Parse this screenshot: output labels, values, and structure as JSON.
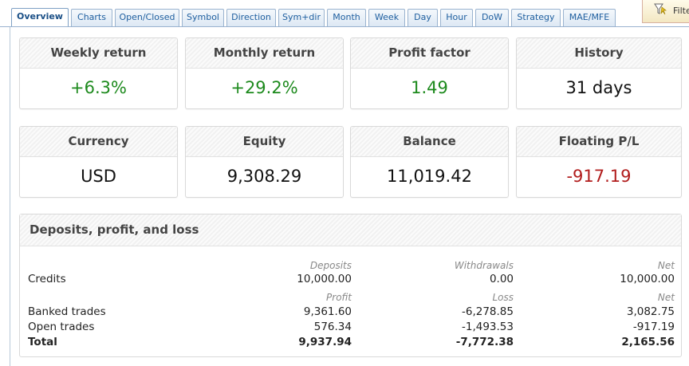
{
  "tabs": [
    {
      "label": "Overview",
      "active": true
    },
    {
      "label": "Charts"
    },
    {
      "label": "Open/Closed"
    },
    {
      "label": "Symbol"
    },
    {
      "label": "Direction"
    },
    {
      "label": "Sym+dir"
    },
    {
      "label": "Month"
    },
    {
      "label": "Week"
    },
    {
      "label": "Day"
    },
    {
      "label": "Hour"
    },
    {
      "label": "DoW"
    },
    {
      "label": "Strategy"
    },
    {
      "label": "MAE/MFE"
    }
  ],
  "filter": {
    "label": "Filte",
    "icon": "filter-funnel-icon"
  },
  "stats": {
    "weekly_return": {
      "title": "Weekly return",
      "value": "+6.3%"
    },
    "monthly_return": {
      "title": "Monthly return",
      "value": "+29.2%"
    },
    "profit_factor": {
      "title": "Profit factor",
      "value": "1.49"
    },
    "history": {
      "title": "History",
      "value": "31 days"
    },
    "currency": {
      "title": "Currency",
      "value": "USD"
    },
    "equity": {
      "title": "Equity",
      "value": "9,308.29"
    },
    "balance": {
      "title": "Balance",
      "value": "11,019.42"
    },
    "floating_pl": {
      "title": "Floating P/L",
      "value": "-917.19"
    }
  },
  "colors": {
    "positive": "#1d8a1d",
    "negative": "#b11c1c",
    "tab_text": "#1f5f9f"
  },
  "dpl": {
    "title": "Deposits, profit, and loss",
    "header1": {
      "c1": "Deposits",
      "c2": "Withdrawals",
      "c3": "Net"
    },
    "credits": {
      "label": "Credits",
      "c1": "10,000.00",
      "c2": "0.00",
      "c3": "10,000.00"
    },
    "header2": {
      "c1": "Profit",
      "c2": "Loss",
      "c3": "Net"
    },
    "banked": {
      "label": "Banked trades",
      "c1": "9,361.60",
      "c2": "-6,278.85",
      "c3": "3,082.75"
    },
    "open": {
      "label": "Open trades",
      "c1": "576.34",
      "c2": "-1,493.53",
      "c3": "-917.19"
    },
    "total": {
      "label": "Total",
      "c1": "9,937.94",
      "c2": "-7,772.38",
      "c3": "2,165.56"
    }
  }
}
